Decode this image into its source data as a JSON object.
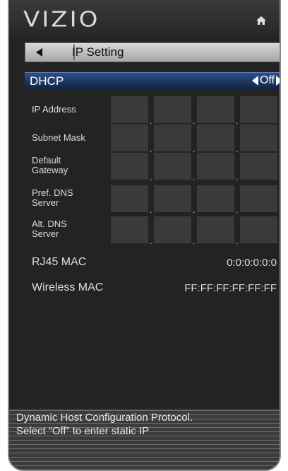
{
  "header": {
    "logo": "VIZIO",
    "home_icon": "home-icon"
  },
  "title_bar": {
    "back_icon": "back-arrow-icon",
    "title": "IP Setting"
  },
  "dhcp": {
    "label": "DHCP",
    "value": "Off"
  },
  "fields": [
    {
      "label_line1": "IP Address",
      "label_line2": ""
    },
    {
      "label_line1": "Subnet Mask",
      "label_line2": ""
    },
    {
      "label_line1": "Default",
      "label_line2": "Gateway"
    },
    {
      "label_line1": "Pref. DNS",
      "label_line2": "Server"
    },
    {
      "label_line1": "Alt. DNS",
      "label_line2": "Server"
    }
  ],
  "info": [
    {
      "label": "RJ45 MAC",
      "value": "0:0:0:0:0:0"
    },
    {
      "label": "Wireless MAC",
      "value": "FF:FF:FF:FF:FF:FF"
    }
  ],
  "help": {
    "line1": "Dynamic Host Configuration Protocol.",
    "line2": "Select “Off” to enter static IP"
  },
  "colors": {
    "highlight": "#1f3b66",
    "panel": "#232323",
    "field": "#3a3a3a"
  }
}
